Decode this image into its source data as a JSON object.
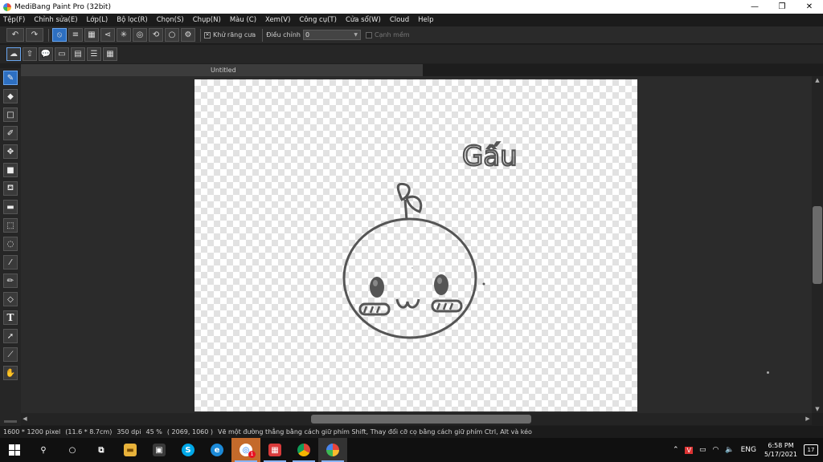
{
  "window": {
    "title": "MediBang Paint Pro (32bit)",
    "minimize": "—",
    "restore": "❐",
    "close": "✕"
  },
  "menu": {
    "items": [
      "Tệp(F)",
      "Chỉnh sửa(E)",
      "Lớp(L)",
      "Bộ lọc(R)",
      "Chọn(S)",
      "Chụp(N)",
      "Màu (C)",
      "Xem(V)",
      "Công cụ(T)",
      "Cửa sổ(W)",
      "Cloud",
      "Help"
    ]
  },
  "options": {
    "antialias_label": "Khử răng cưa",
    "antialias_checked": true,
    "correction_label": "Điều chỉnh",
    "correction_value": "0",
    "smooth_label": "Cạnh mềm",
    "smooth_checked": false
  },
  "document": {
    "tab_title": "Untitled",
    "drawing_text": "Gấu"
  },
  "status": {
    "size": "1600 * 1200 pixel",
    "size_cm": "(11.6 * 8.7cm)",
    "dpi": "350 dpi",
    "zoom": "45 %",
    "coords": "( 2069, 1060 )",
    "hint": "Vẽ một đường thẳng bằng cách giữ phím Shift, Thay đổi cỡ cọ bằng cách giữ phím Ctrl, Alt và kéo"
  },
  "taskbar": {
    "lang": "ENG",
    "time": "6:58 PM",
    "date": "5/17/2021",
    "notifications": "17",
    "badge": "1"
  },
  "colors": {
    "accent": "#2d6fc1",
    "drawing_stroke": "#555555"
  }
}
